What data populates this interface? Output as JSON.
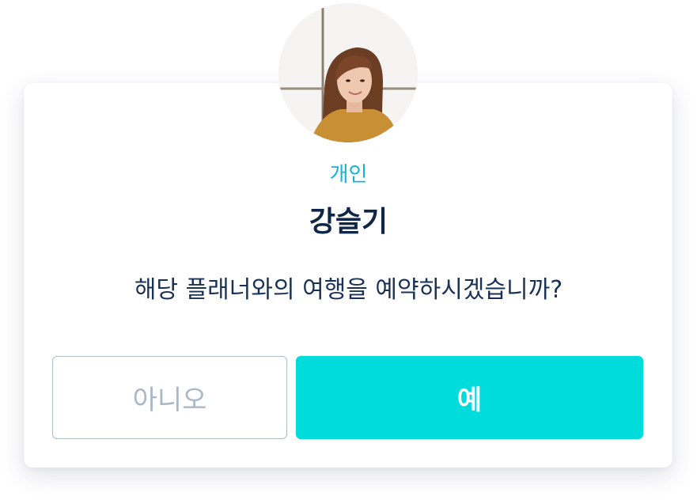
{
  "dialog": {
    "planner_type": "개인",
    "planner_name": "강슬기",
    "question": "해당 플래너와의 여행을 예약하시겠습니까?",
    "buttons": {
      "no_label": "아니오",
      "yes_label": "예"
    }
  },
  "colors": {
    "accent_cyan": "#00dcdc",
    "label_blue": "#14b4d4",
    "title_navy": "#0f2646",
    "text_navy": "#1a3156",
    "secondary_border": "#aebecb",
    "secondary_text": "#a8b8c6"
  }
}
